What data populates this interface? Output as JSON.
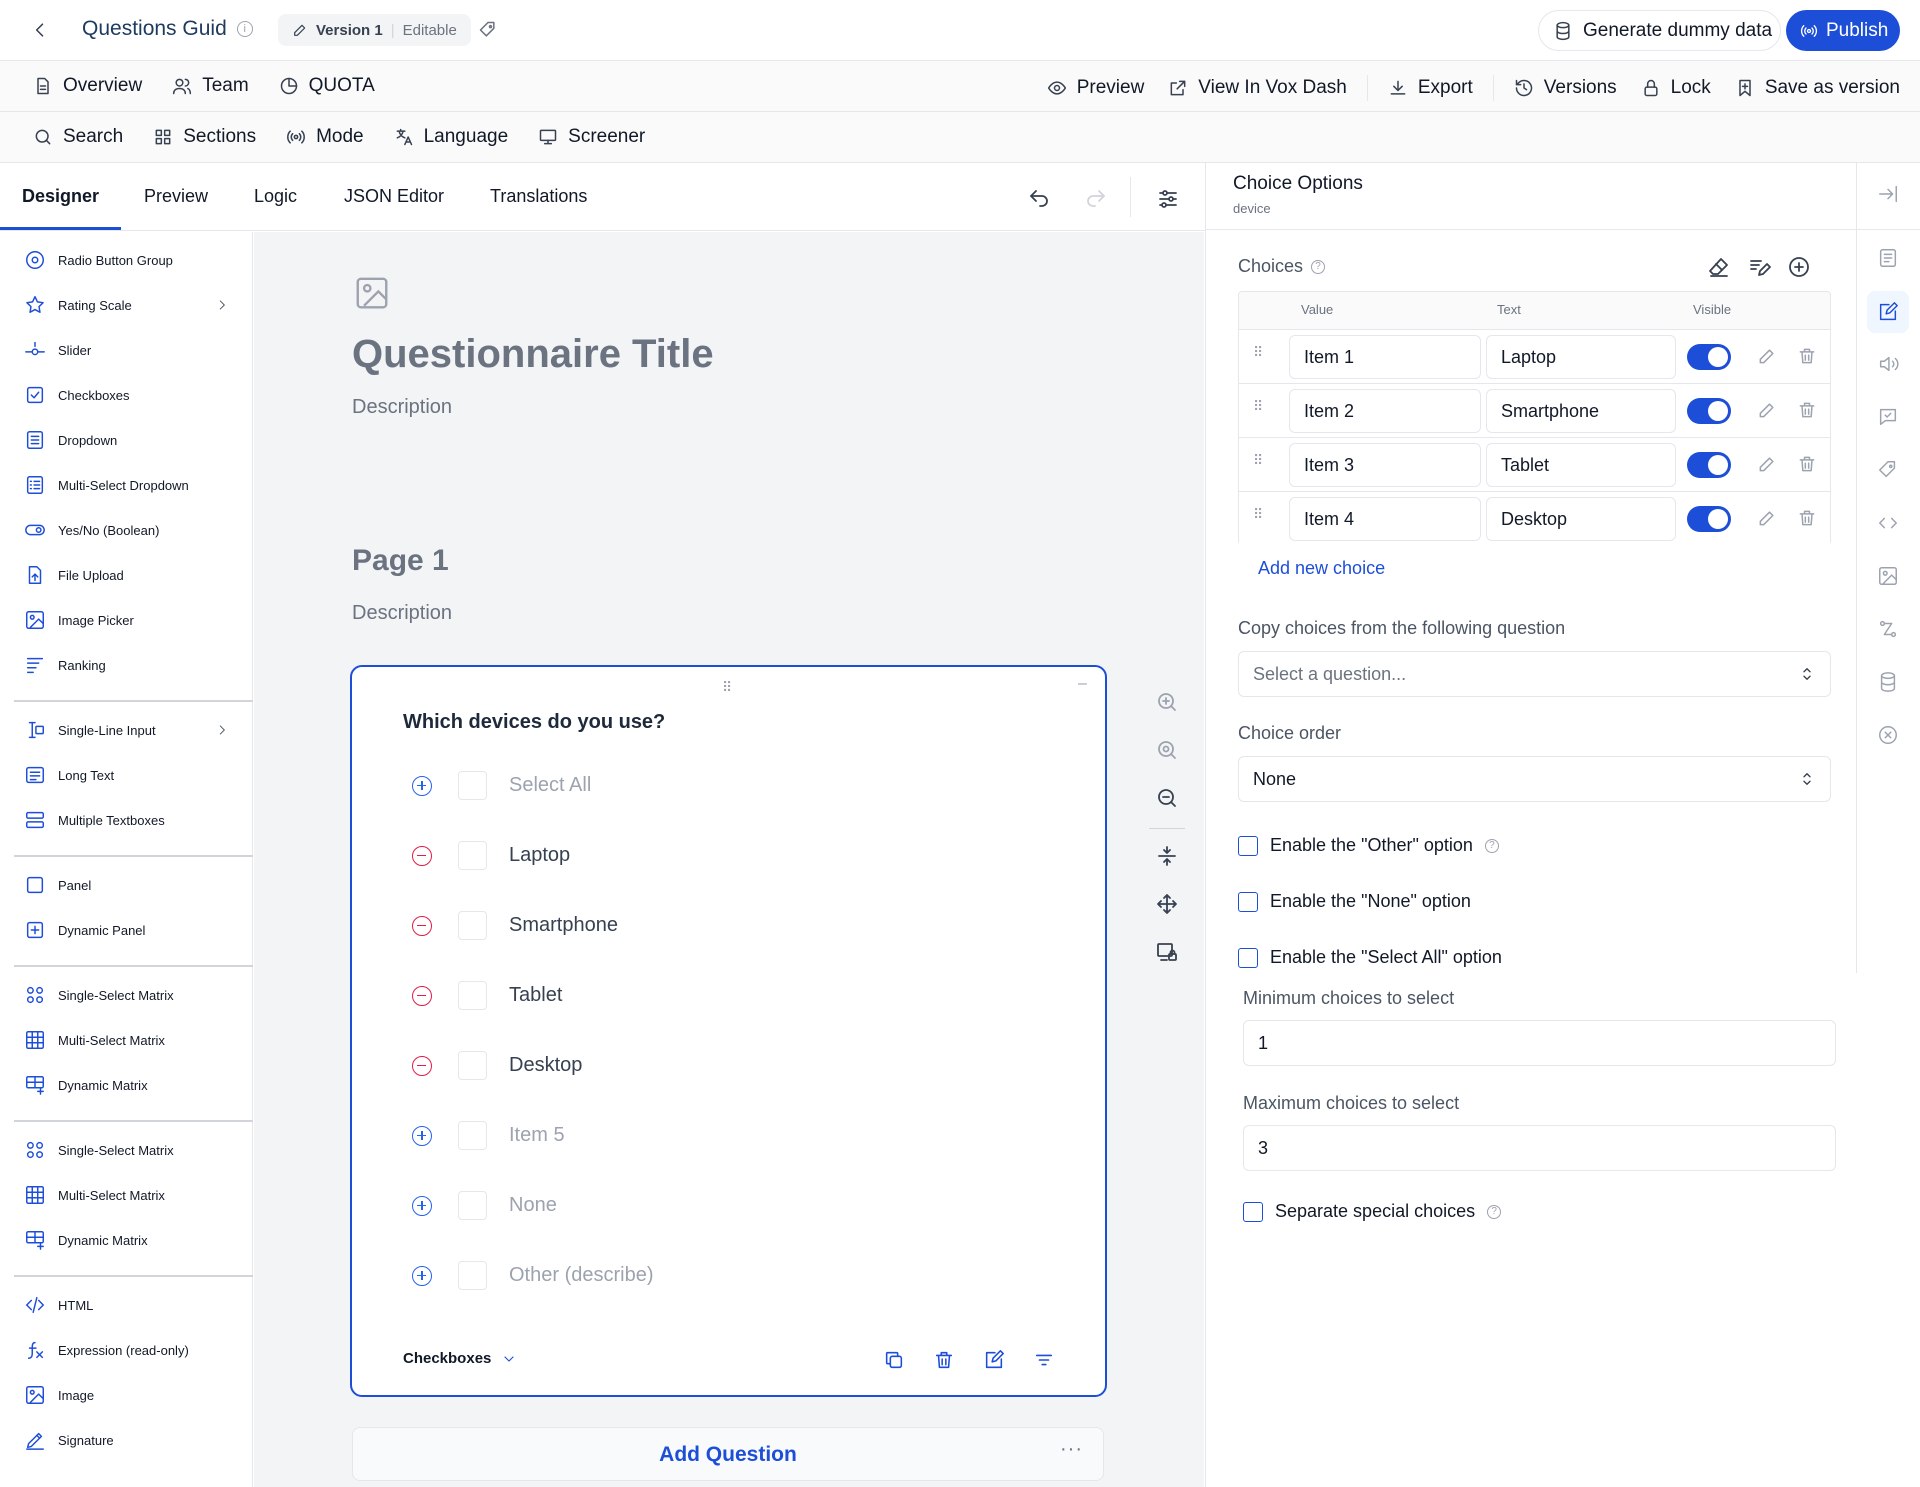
{
  "header": {
    "title": "Questions Guid",
    "version_label": "Version 1",
    "version_status": "Editable",
    "generate_button": "Generate dummy data",
    "publish_button": "Publish"
  },
  "nav_primary": {
    "left": [
      {
        "label": "Overview",
        "icon": "document-icon"
      },
      {
        "label": "Team",
        "icon": "users-icon"
      },
      {
        "label": "QUOTA",
        "icon": "pie-icon"
      }
    ],
    "right": [
      {
        "label": "Preview",
        "icon": "eye-icon"
      },
      {
        "label": "View In Vox Dash",
        "icon": "external-link-icon"
      },
      {
        "label": "Export",
        "icon": "download-icon"
      },
      {
        "label": "Versions",
        "icon": "history-icon"
      },
      {
        "label": "Lock",
        "icon": "lock-icon"
      },
      {
        "label": "Save as version",
        "icon": "bookmark-icon"
      }
    ]
  },
  "nav_secondary": [
    {
      "label": "Search",
      "icon": "search-icon"
    },
    {
      "label": "Sections",
      "icon": "grid-icon"
    },
    {
      "label": "Mode",
      "icon": "broadcast-icon"
    },
    {
      "label": "Language",
      "icon": "translate-icon"
    },
    {
      "label": "Screener",
      "icon": "monitor-icon"
    }
  ],
  "tabs": [
    "Designer",
    "Preview",
    "Logic",
    "JSON Editor",
    "Translations"
  ],
  "active_tab": "Designer",
  "toolbox": [
    "Radio Button Group",
    "Rating Scale",
    "Slider",
    "Checkboxes",
    "Dropdown",
    "Multi-Select Dropdown",
    "Yes/No (Boolean)",
    "File Upload",
    "Image Picker",
    "Ranking",
    "Single-Line Input",
    "Long Text",
    "Multiple Textboxes",
    "Panel",
    "Dynamic Panel",
    "Single-Select Matrix",
    "Multi-Select Matrix",
    "Dynamic Matrix",
    "Single-Select Matrix",
    "Multi-Select Matrix",
    "Dynamic Matrix",
    "HTML",
    "Expression (read-only)",
    "Image",
    "Signature"
  ],
  "survey": {
    "title": "Questionnaire Title",
    "description": "Description",
    "page_title": "Page 1",
    "page_description": "Description",
    "question": "Which devices do you use?",
    "choices": [
      {
        "label": "Select All",
        "kind": "plus",
        "muted": true
      },
      {
        "label": "Laptop",
        "kind": "minus",
        "muted": false
      },
      {
        "label": "Smartphone",
        "kind": "minus",
        "muted": false
      },
      {
        "label": "Tablet",
        "kind": "minus",
        "muted": false
      },
      {
        "label": "Desktop",
        "kind": "minus",
        "muted": false
      },
      {
        "label": "Item 5",
        "kind": "plus",
        "muted": true
      },
      {
        "label": "None",
        "kind": "plus",
        "muted": true
      },
      {
        "label": "Other (describe)",
        "kind": "plus",
        "muted": true
      }
    ],
    "question_type": "Checkboxes",
    "add_question": "Add Question"
  },
  "panel": {
    "title": "Choice Options",
    "subtitle": "device",
    "choices_label": "Choices",
    "columns": [
      "Value",
      "Text",
      "Visible"
    ],
    "rows": [
      {
        "value": "Item 1",
        "text": "Laptop",
        "visible": true
      },
      {
        "value": "Item 2",
        "text": "Smartphone",
        "visible": true
      },
      {
        "value": "Item 3",
        "text": "Tablet",
        "visible": true
      },
      {
        "value": "Item 4",
        "text": "Desktop",
        "visible": true
      }
    ],
    "add_choice": "Add new choice",
    "copy_label": "Copy choices from the following question",
    "copy_placeholder": "Select a question...",
    "order_label": "Choice order",
    "order_value": "None",
    "enable_other": "Enable the \"Other\" option",
    "enable_none": "Enable the \"None\" option",
    "enable_select_all": "Enable the \"Select All\" option",
    "min_label": "Minimum choices to select",
    "min_value": "1",
    "max_label": "Maximum choices to select",
    "max_value": "3",
    "separate_label": "Separate special choices"
  },
  "colors": {
    "accent": "#1d4ed8",
    "danger": "#e11d48",
    "canvas": "#f3f4f6"
  }
}
